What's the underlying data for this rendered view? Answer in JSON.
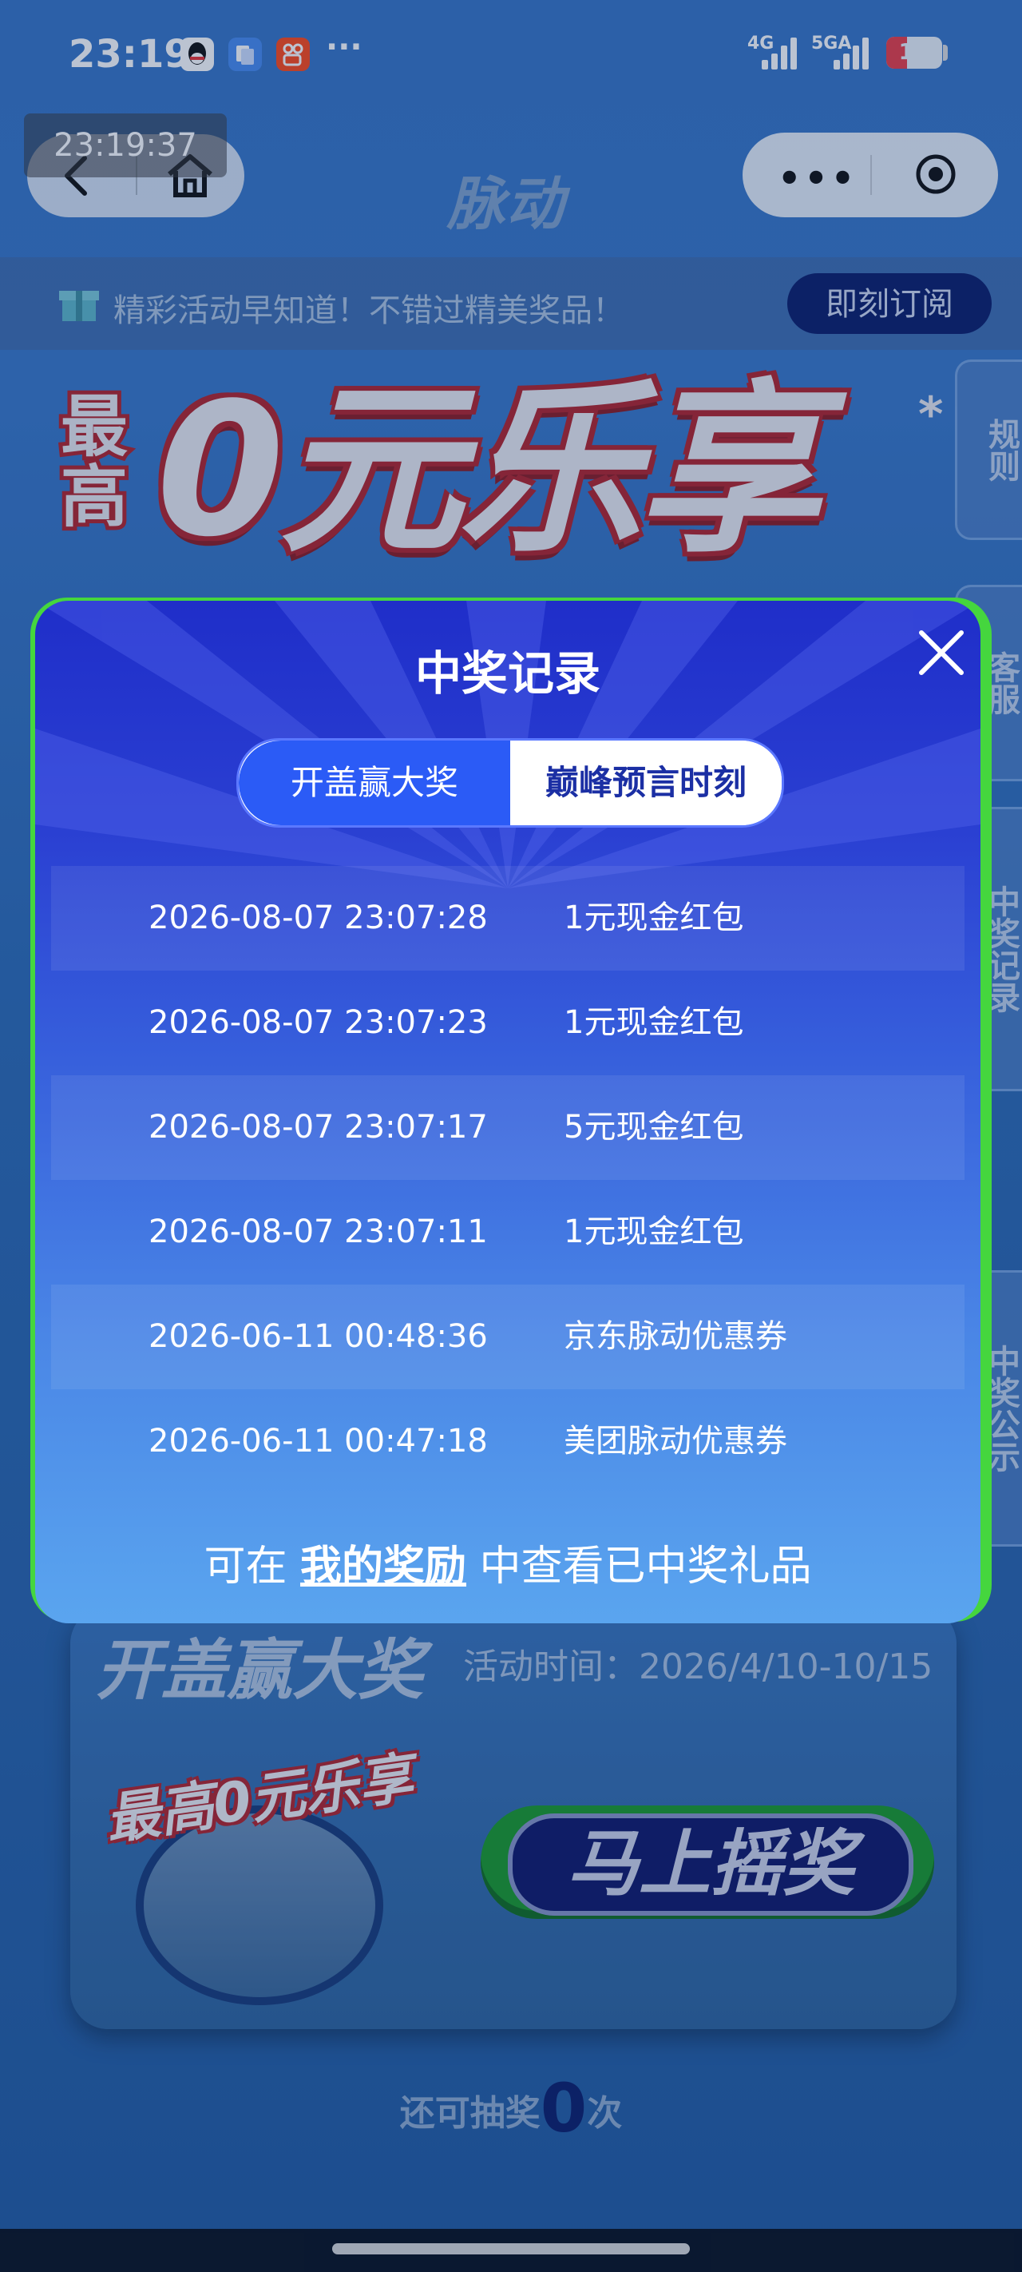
{
  "status_bar": {
    "time": "23:19",
    "net1": "4G",
    "net2": "5GA",
    "battery": "12",
    "more": "···"
  },
  "time_overlay": "23:19:37",
  "nav": {
    "brand": "脉动",
    "capsule_more": "•••"
  },
  "subscribe": {
    "text": "精彩活动早知道！不错过精美奖品！",
    "button": "即刻订阅"
  },
  "hero": {
    "small": "最高",
    "big": "0元乐享",
    "star": "*"
  },
  "side_tabs": [
    "规则",
    "客服",
    "中奖记录",
    "中奖公示"
  ],
  "card": {
    "title": "开盖赢大奖",
    "time_label": "活动时间：",
    "time_value": "2026/4/10-10/15",
    "mini_logo": "最高0元乐享",
    "shake_button": "马上摇奖",
    "chances_prefix": "还可抽奖",
    "chances_value": "0",
    "chances_suffix": "次"
  },
  "modal": {
    "title": "中奖记录",
    "tabs": [
      {
        "label": "开盖赢大奖",
        "active": true
      },
      {
        "label": "巅峰预言时刻",
        "active": false
      }
    ],
    "records": [
      {
        "time": "2026-08-07 23:07:28",
        "prize": "1元现金红包"
      },
      {
        "time": "2026-08-07 23:07:23",
        "prize": "1元现金红包"
      },
      {
        "time": "2026-08-07 23:07:17",
        "prize": "5元现金红包"
      },
      {
        "time": "2026-08-07 23:07:11",
        "prize": "1元现金红包"
      },
      {
        "time": "2026-06-11 00:48:36",
        "prize": "京东脉动优惠券"
      },
      {
        "time": "2026-06-11 00:47:18",
        "prize": "美团脉动优惠券"
      }
    ],
    "footer_prefix": "可在 ",
    "footer_link": "我的奖励",
    "footer_suffix": " 中查看已中奖礼品"
  },
  "colors": {
    "modal_top": "#1f2ec9",
    "modal_bottom": "#5aa5ef",
    "modal_glow": "#45d63e",
    "tab_active": "#2b5bf6",
    "subscribe_btn": "#0d1f6b",
    "hero_red": "#b4252c"
  }
}
